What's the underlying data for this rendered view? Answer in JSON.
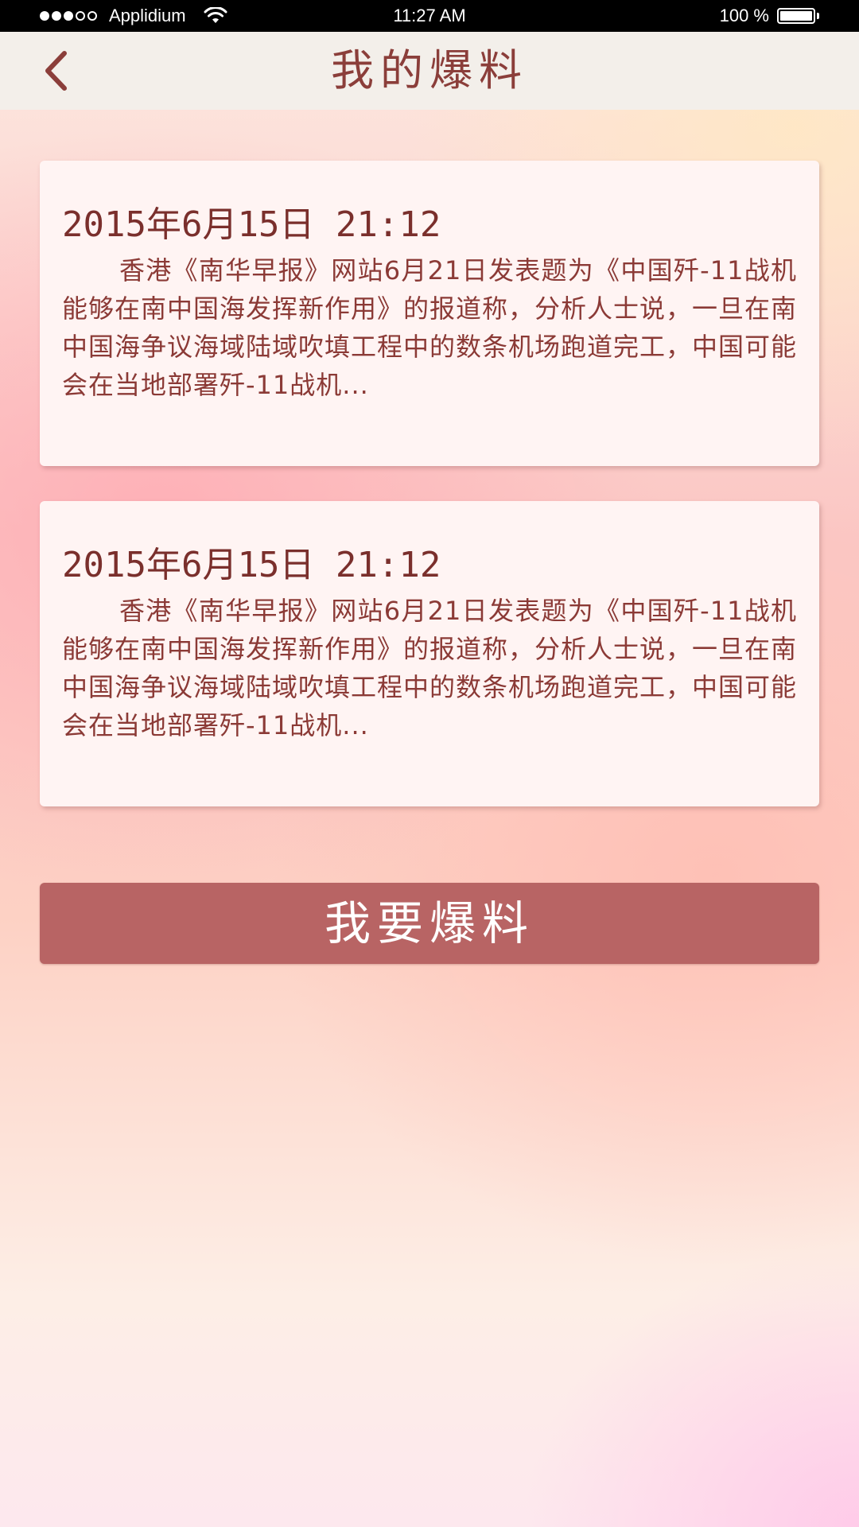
{
  "status_bar": {
    "carrier": "Applidium",
    "signal_filled": 3,
    "signal_total": 5,
    "time": "11:27 AM",
    "battery_percent": "100 %",
    "icons": [
      "wifi-icon",
      "battery-icon"
    ]
  },
  "nav": {
    "title": "我的爆料",
    "back_icon": "chevron-left-icon"
  },
  "posts": [
    {
      "date": "2015年6月15日 21:12",
      "body": "香港《南华早报》网站6月21日发表题为《中国歼-11战机能够在南中国海发挥新作用》的报道称，分析人士说，一旦在南中国海争议海域陆域吹填工程中的数条机场跑道完工，中国可能会在当地部署歼-11战机..."
    },
    {
      "date": "2015年6月15日 21:12",
      "body": "香港《南华早报》网站6月21日发表题为《中国歼-11战机能够在南中国海发挥新作用》的报道称，分析人士说，一旦在南中国海争议海域陆域吹填工程中的数条机场跑道完工，中国可能会在当地部署歼-11战机..."
    }
  ],
  "actions": {
    "submit_label": "我要爆料"
  },
  "colors": {
    "accent": "#b86464",
    "title_text": "#8b3e3a",
    "card_bg": "#fff4f3",
    "nav_bg": "#f3efea"
  }
}
